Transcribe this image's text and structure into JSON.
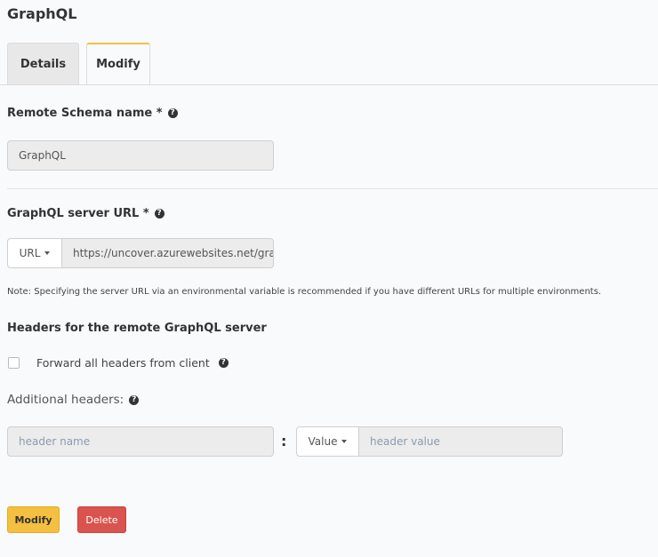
{
  "page": {
    "title": "GraphQL"
  },
  "tabs": [
    {
      "label": "Details",
      "active": false
    },
    {
      "label": "Modify",
      "active": true
    }
  ],
  "schema_name": {
    "label": "Remote Schema name *",
    "value": "GraphQL"
  },
  "server_url": {
    "label": "GraphQL server URL *",
    "type_selected": "URL",
    "value": "https://uncover.azurewebsites.net/graphql",
    "note": "Note: Specifying the server URL via an environmental variable is recommended if you have different URLs for multiple environments."
  },
  "headers": {
    "section_title": "Headers for the remote GraphQL server",
    "forward_label": "Forward all headers from client",
    "forward_checked": false,
    "additional_label": "Additional headers:",
    "name_placeholder": "header name",
    "separator": ":",
    "value_type_selected": "Value",
    "value_placeholder": "header value"
  },
  "actions": {
    "modify_label": "Modify",
    "delete_label": "Delete"
  },
  "colors": {
    "accent": "#f5bf3f",
    "danger": "#d9534f",
    "background": "#f8fafb"
  }
}
